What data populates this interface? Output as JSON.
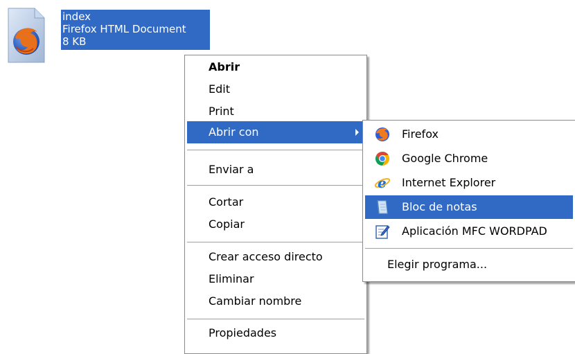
{
  "file": {
    "name": "index",
    "type": "Firefox HTML Document",
    "size": "8 KB"
  },
  "context_menu": {
    "items": [
      {
        "label": "Abrir",
        "bold": true
      },
      {
        "label": "Edit"
      },
      {
        "label": "Print"
      },
      {
        "label": "Abrir con",
        "highlighted": true,
        "submenu": true
      },
      {
        "label": "Enviar a"
      },
      {
        "label": "Cortar"
      },
      {
        "label": "Copiar"
      },
      {
        "label": "Crear acceso directo"
      },
      {
        "label": "Eliminar"
      },
      {
        "label": "Cambiar nombre"
      },
      {
        "label": "Propiedades"
      }
    ]
  },
  "open_with_submenu": {
    "items": [
      {
        "label": "Firefox",
        "icon": "firefox-icon"
      },
      {
        "label": "Google Chrome",
        "icon": "chrome-icon"
      },
      {
        "label": "Internet Explorer",
        "icon": "internet-explorer-icon"
      },
      {
        "label": "Bloc de notas",
        "icon": "notepad-icon",
        "highlighted": true
      },
      {
        "label": "Aplicación MFC WORDPAD",
        "icon": "wordpad-icon"
      }
    ],
    "choose_program": "Elegir programa..."
  },
  "colors": {
    "selection": "#316ac5",
    "menu_background": "#ffffff",
    "separator": "#a0a0a0"
  }
}
